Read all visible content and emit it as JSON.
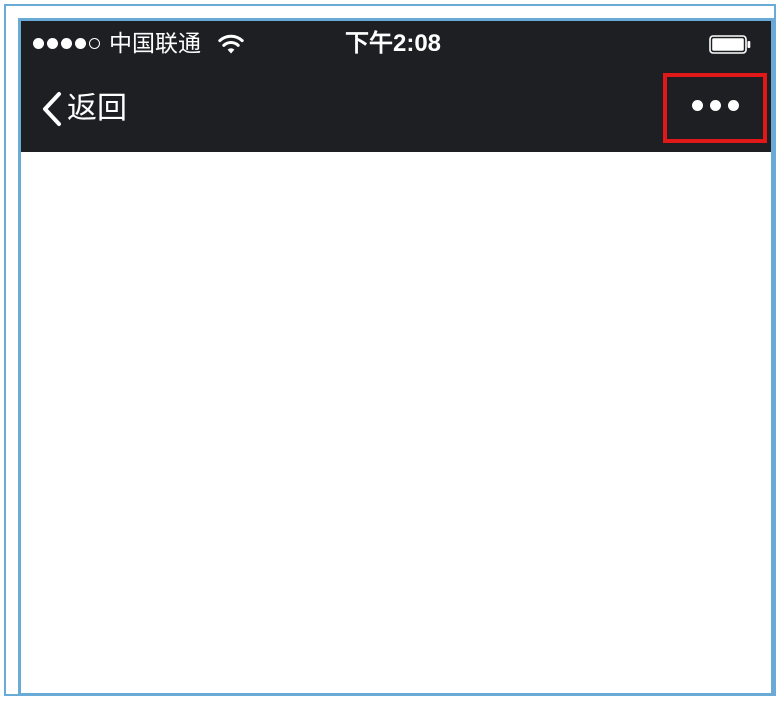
{
  "status_bar": {
    "signal_strength_filled": 4,
    "signal_strength_total": 5,
    "carrier": "中国联通",
    "wifi_icon": "wifi-icon",
    "time": "下午2:08",
    "battery_icon": "battery-icon",
    "battery_level": 1.0
  },
  "nav_bar": {
    "back_icon": "chevron-left-icon",
    "back_label": "返回",
    "more_icon": "ellipsis-icon",
    "more_highlight_color": "#e01818"
  },
  "colors": {
    "nav_background": "#1e1f22",
    "frame_border": "#6aaad6",
    "content_background": "#ffffff"
  }
}
